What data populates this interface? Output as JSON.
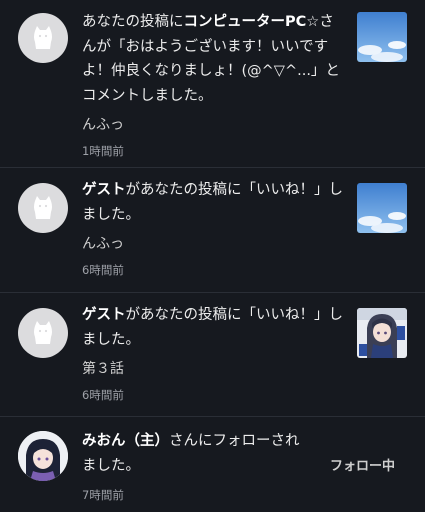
{
  "notifications": [
    {
      "kind": "comment",
      "actor": "コンピューターPC☆",
      "prefix": "あなたの投稿に",
      "suffix": "さんが「おはようございます！いいですよ！仲良くなりましょ！(@^▽^...」とコメントしました。",
      "excerpt": "んふっ",
      "time": "1時間前",
      "thumb_icon": "sky-clouds-thumbnail"
    },
    {
      "kind": "like",
      "actor": "ゲスト",
      "suffix": "があなたの投稿に「いいね！」しました。",
      "excerpt": "んふっ",
      "time": "6時間前",
      "thumb_icon": "sky-clouds-thumbnail"
    },
    {
      "kind": "like",
      "actor": "ゲスト",
      "suffix": "があなたの投稿に「いいね！」しました。",
      "excerpt": "第３話",
      "time": "6時間前",
      "thumb_icon": "anime-girl-thumbnail"
    },
    {
      "kind": "follow",
      "actor": "みおん（主）",
      "suffix": "さんにフォローされました。",
      "time": "7時間前",
      "follow_label": "フォロー中"
    }
  ],
  "colors": {
    "background": "#16191f",
    "divider": "#2a2e36",
    "text": "#e8e8e8",
    "time": "#9ea1a8"
  }
}
